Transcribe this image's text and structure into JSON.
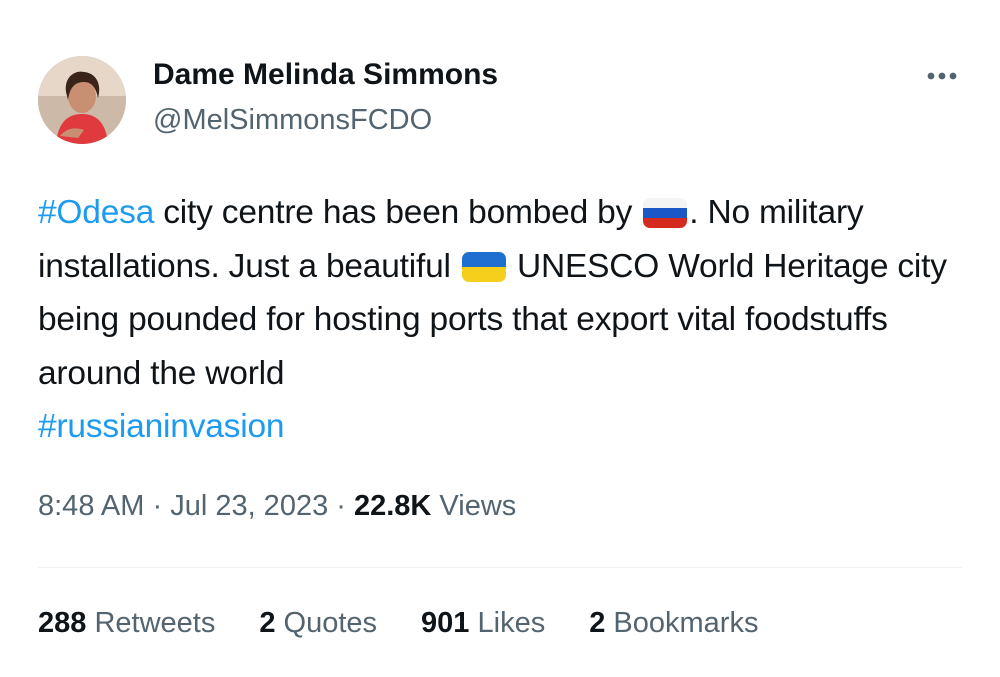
{
  "author": {
    "display_name": "Dame Melinda Simmons",
    "handle": "@MelSimmonsFCDO"
  },
  "tweet": {
    "hashtag_1": "#Odesa",
    "text_1": " city centre has been bombed by ",
    "flag_1": "russia-flag-icon",
    "text_2": ". No military installations. Just a beautiful ",
    "flag_2": "ukraine-flag-icon",
    "text_3": " UNESCO World Heritage city being pounded for hosting ports that export vital foodstuffs around the world",
    "hashtag_2": "#russianinvasion"
  },
  "meta": {
    "time": "8:48 AM",
    "separator_1": " · ",
    "date": "Jul 23, 2023",
    "separator_2": " · ",
    "views_count": "22.8K",
    "views_label": " Views"
  },
  "stats": {
    "retweets_count": "288",
    "retweets_label": " Retweets",
    "quotes_count": "2",
    "quotes_label": " Quotes",
    "likes_count": "901",
    "likes_label": " Likes",
    "bookmarks_count": "2",
    "bookmarks_label": " Bookmarks"
  },
  "colors": {
    "link": "#1d9bf0",
    "secondary_text": "#536471",
    "primary_text": "#0f1419"
  }
}
